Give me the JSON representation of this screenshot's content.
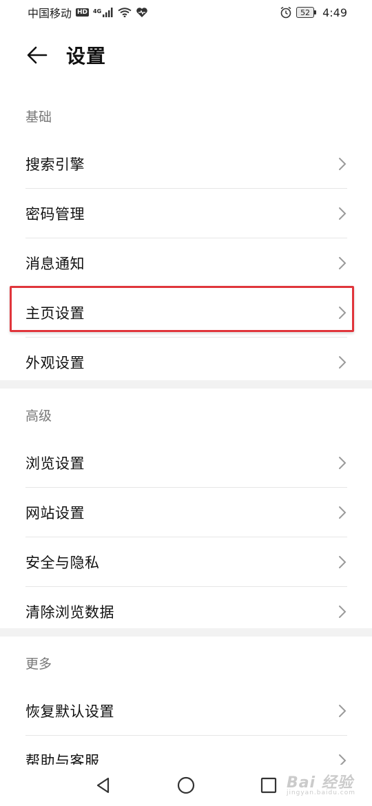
{
  "status_bar": {
    "carrier": "中国移动",
    "hd": "HD",
    "network": "4G",
    "battery": "52",
    "time": "4:49"
  },
  "header": {
    "title": "设置"
  },
  "sections": [
    {
      "title": "基础",
      "items": [
        "搜索引擎",
        "密码管理",
        "消息通知",
        "主页设置",
        "外观设置"
      ]
    },
    {
      "title": "高级",
      "items": [
        "浏览设置",
        "网站设置",
        "安全与隐私",
        "清除浏览数据"
      ]
    },
    {
      "title": "更多",
      "items": [
        "恢复默认设置",
        "帮助与客服"
      ]
    }
  ],
  "highlighted_item": "主页设置",
  "watermark": {
    "text": "Bai 经验",
    "sub": "jingyan.baidu.com"
  },
  "colors": {
    "highlight": "#e0353b",
    "divider_band": "#f2f2f2",
    "section_header": "#777777"
  }
}
